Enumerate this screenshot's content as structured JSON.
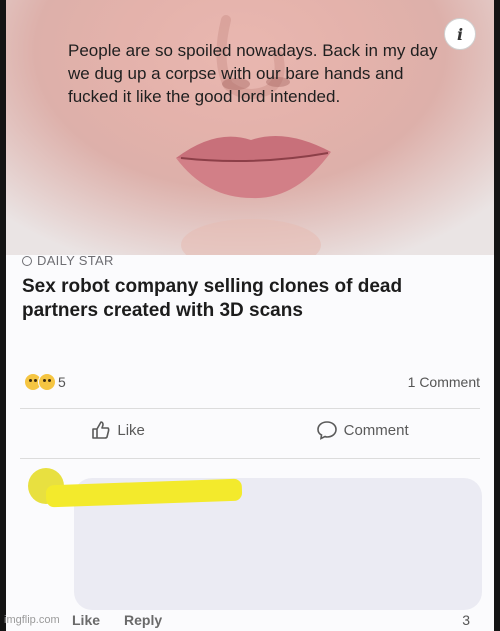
{
  "post": {
    "info_badge": "i",
    "source": "DAILY STAR",
    "headline": "Sex robot company selling clones of dead partners created with 3D scans",
    "reaction_count": "5",
    "comment_count": "1 Comment",
    "like_label": "Like",
    "comment_label": "Comment"
  },
  "comment": {
    "text": "People are so spoiled nowadays. Back in my day we dug up a corpse with our bare hands and fucked it like the good lord intended.",
    "like_label": "Like",
    "reply_label": "Reply",
    "reaction_count": "3"
  },
  "watermark": "imgflip.com",
  "colors": {
    "card_bg": "#fbfbfd",
    "bubble_bg": "#ebebf3",
    "scribble": "#f3ea2c",
    "frame": "#141414"
  },
  "icons": [
    "info-icon",
    "globe-icon",
    "reaction-icon",
    "like-icon",
    "comment-icon"
  ]
}
